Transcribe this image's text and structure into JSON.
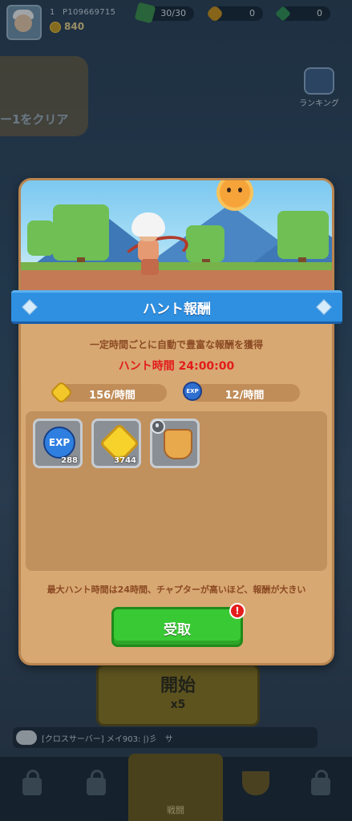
{
  "player": {
    "level": "1",
    "id": "P109669715",
    "gold": "840"
  },
  "resources": {
    "energy": "30/30",
    "coins": "0",
    "gems": "0"
  },
  "ranking_label": "ランキング",
  "background": {
    "clear_text": "ー1をクリア",
    "start_label": "開始",
    "start_cost": "x5",
    "chat_text": "[クロスサーバー] メイ903: |)彡　サ",
    "nav_battle_label": "戦闘"
  },
  "modal": {
    "title": "ハント報酬",
    "description": "一定時間ごとに自動で豊富な報酬を獲得",
    "hunt_time": "ハント時間 24:00:00",
    "coin_rate": "156/時間",
    "exp_rate": "12/時間",
    "exp_icon_text": "EXP",
    "rewards": [
      {
        "name": "exp",
        "label": "EXP",
        "qty": "288"
      },
      {
        "name": "gold",
        "label": "",
        "qty": "3744"
      },
      {
        "name": "armor",
        "label": "",
        "qty": ""
      }
    ],
    "note": "最大ハント時間は24時間、チャプターが高いほど、報酬が大きい",
    "claim_label": "受取",
    "alert_mark": "!"
  },
  "colors": {
    "ribbon_blue": "#2f8fe0",
    "claim_green": "#39c934",
    "hunt_time_red": "#e21c1c",
    "modal_tan": "#d8a872"
  }
}
